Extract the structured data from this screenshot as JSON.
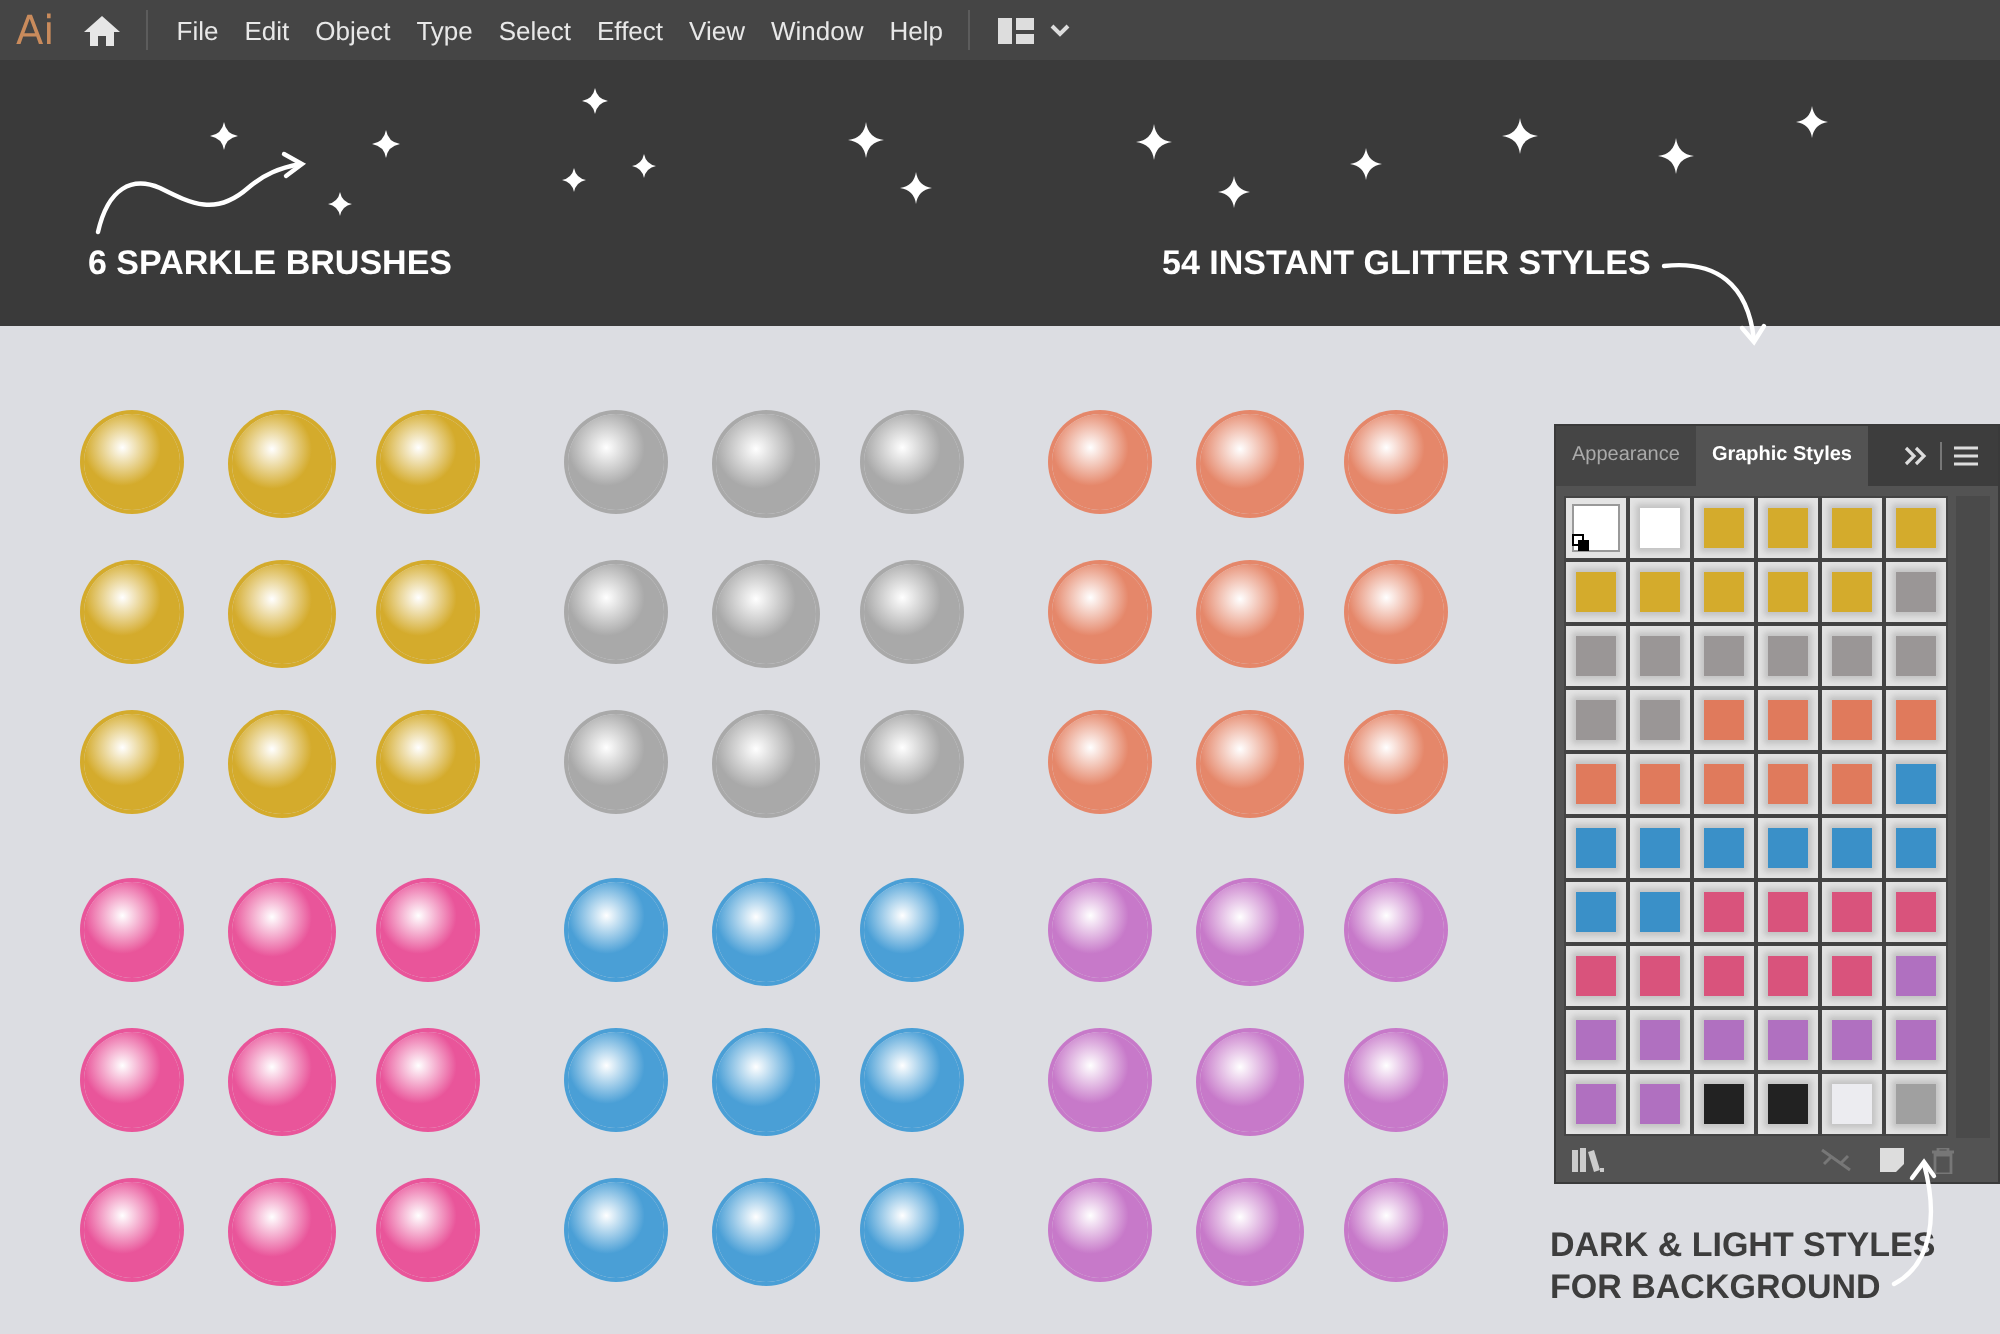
{
  "app": {
    "logo": "Ai",
    "menu": [
      "File",
      "Edit",
      "Object",
      "Type",
      "Select",
      "Effect",
      "View",
      "Window",
      "Help"
    ]
  },
  "banner": {
    "captions": [
      "6 SPARKLE BRUSHES",
      "54 INSTANT GLITTER STYLES"
    ]
  },
  "canvas": {
    "groups": [
      {
        "color": "#d4ab2c"
      },
      {
        "color": "#a9a9a9"
      },
      {
        "color": "#e5876a"
      },
      {
        "color": "#e9559a"
      },
      {
        "color": "#4a9fd6"
      },
      {
        "color": "#c779c9"
      }
    ]
  },
  "panel": {
    "tabs": [
      {
        "label": "Appearance",
        "selected": false
      },
      {
        "label": "Graphic Styles",
        "selected": true
      }
    ],
    "swatches": [
      {
        "color": "#ffffff",
        "selected": true
      },
      {
        "color": "#ffffff",
        "selected": false
      },
      {
        "color": "#d4ab2c",
        "selected": false
      },
      {
        "color": "#d4ab2c",
        "selected": false
      },
      {
        "color": "#d4ab2c",
        "selected": false
      },
      {
        "color": "#d4ab2c",
        "selected": false
      },
      {
        "color": "#d4ab2c",
        "selected": false
      },
      {
        "color": "#d4ab2c",
        "selected": false
      },
      {
        "color": "#d4ab2c",
        "selected": false
      },
      {
        "color": "#d4ab2c",
        "selected": false
      },
      {
        "color": "#d4ab2c",
        "selected": false
      },
      {
        "color": "#9a9696",
        "selected": false
      },
      {
        "color": "#9a9696",
        "selected": false
      },
      {
        "color": "#9a9696",
        "selected": false
      },
      {
        "color": "#9a9696",
        "selected": false
      },
      {
        "color": "#9a9696",
        "selected": false
      },
      {
        "color": "#9a9696",
        "selected": false
      },
      {
        "color": "#9a9696",
        "selected": false
      },
      {
        "color": "#9a9696",
        "selected": false
      },
      {
        "color": "#9a9696",
        "selected": false
      },
      {
        "color": "#e07a5c",
        "selected": false
      },
      {
        "color": "#e07a5c",
        "selected": false
      },
      {
        "color": "#e07a5c",
        "selected": false
      },
      {
        "color": "#e07a5c",
        "selected": false
      },
      {
        "color": "#e07a5c",
        "selected": false
      },
      {
        "color": "#e07a5c",
        "selected": false
      },
      {
        "color": "#e07a5c",
        "selected": false
      },
      {
        "color": "#e07a5c",
        "selected": false
      },
      {
        "color": "#e07a5c",
        "selected": false
      },
      {
        "color": "#3a90c8",
        "selected": false
      },
      {
        "color": "#3a90c8",
        "selected": false
      },
      {
        "color": "#3a90c8",
        "selected": false
      },
      {
        "color": "#3a90c8",
        "selected": false
      },
      {
        "color": "#3a90c8",
        "selected": false
      },
      {
        "color": "#3a90c8",
        "selected": false
      },
      {
        "color": "#3a90c8",
        "selected": false
      },
      {
        "color": "#3a90c8",
        "selected": false
      },
      {
        "color": "#3a90c8",
        "selected": false
      },
      {
        "color": "#d9537c",
        "selected": false
      },
      {
        "color": "#d9537c",
        "selected": false
      },
      {
        "color": "#d9537c",
        "selected": false
      },
      {
        "color": "#d9537c",
        "selected": false
      },
      {
        "color": "#d9537c",
        "selected": false
      },
      {
        "color": "#d9537c",
        "selected": false
      },
      {
        "color": "#d9537c",
        "selected": false
      },
      {
        "color": "#d9537c",
        "selected": false
      },
      {
        "color": "#d9537c",
        "selected": false
      },
      {
        "color": "#b070c0",
        "selected": false
      },
      {
        "color": "#b070c0",
        "selected": false
      },
      {
        "color": "#b070c0",
        "selected": false
      },
      {
        "color": "#b070c0",
        "selected": false
      },
      {
        "color": "#b070c0",
        "selected": false
      },
      {
        "color": "#b070c0",
        "selected": false
      },
      {
        "color": "#b070c0",
        "selected": false
      },
      {
        "color": "#b070c0",
        "selected": false
      },
      {
        "color": "#b070c0",
        "selected": false
      },
      {
        "color": "#222222",
        "selected": false
      },
      {
        "color": "#222222",
        "selected": false
      },
      {
        "color": "#ececf0",
        "selected": false
      },
      {
        "color": "#a0a0a0",
        "selected": false
      }
    ]
  },
  "note": "DARK & LIGHT STYLES FOR BACKGROUND"
}
